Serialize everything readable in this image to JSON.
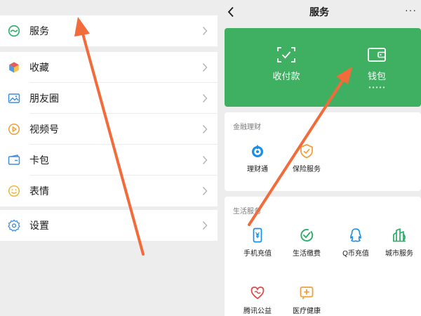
{
  "left_menu": {
    "group1": [
      {
        "label": "服务",
        "icon": "service-icon",
        "color": "#2aae67"
      }
    ],
    "group2": [
      {
        "label": "收藏",
        "icon": "favorites-icon",
        "color": "#e8a33b"
      },
      {
        "label": "朋友圈",
        "icon": "moments-icon",
        "color": "#3d8fe0"
      },
      {
        "label": "视频号",
        "icon": "channels-icon",
        "color": "#f0a03c"
      },
      {
        "label": "卡包",
        "icon": "card-wallet-icon",
        "color": "#3d8fe0"
      },
      {
        "label": "表情",
        "icon": "sticker-icon",
        "color": "#f0b63b"
      }
    ],
    "group3": [
      {
        "label": "设置",
        "icon": "settings-icon",
        "color": "#3d8fe0"
      }
    ]
  },
  "services_page": {
    "title": "服务",
    "back_icon": "back-arrow-icon",
    "more_label": "···",
    "green_card": {
      "color": "#3fb061",
      "items": [
        {
          "label": "收付款",
          "icon": "scan-pay-icon"
        },
        {
          "label": "钱包",
          "icon": "wallet-icon"
        }
      ]
    },
    "financial": {
      "section_label": "金融理财",
      "items": [
        {
          "label": "理财通",
          "icon": "licaitong-icon",
          "color": "#1a8fe8"
        },
        {
          "label": "保险服务",
          "icon": "insurance-icon",
          "color": "#f0a03c"
        }
      ]
    },
    "life": {
      "section_label": "生活服务",
      "items": [
        {
          "label": "手机充值",
          "icon": "phone-recharge-icon",
          "color": "#1a8fe8"
        },
        {
          "label": "生活缴费",
          "icon": "utility-payment-icon",
          "color": "#2aae67"
        },
        {
          "label": "Q币充值",
          "icon": "qcoin-icon",
          "color": "#1a8fe8"
        },
        {
          "label": "城市服务",
          "icon": "city-service-icon",
          "color": "#2aae67"
        },
        {
          "label": "腾讯公益",
          "icon": "charity-icon",
          "color": "#e04a4a"
        },
        {
          "label": "医疗健康",
          "icon": "health-icon",
          "color": "#f0a03c"
        }
      ]
    }
  },
  "annotation_color": "#f26b3a"
}
